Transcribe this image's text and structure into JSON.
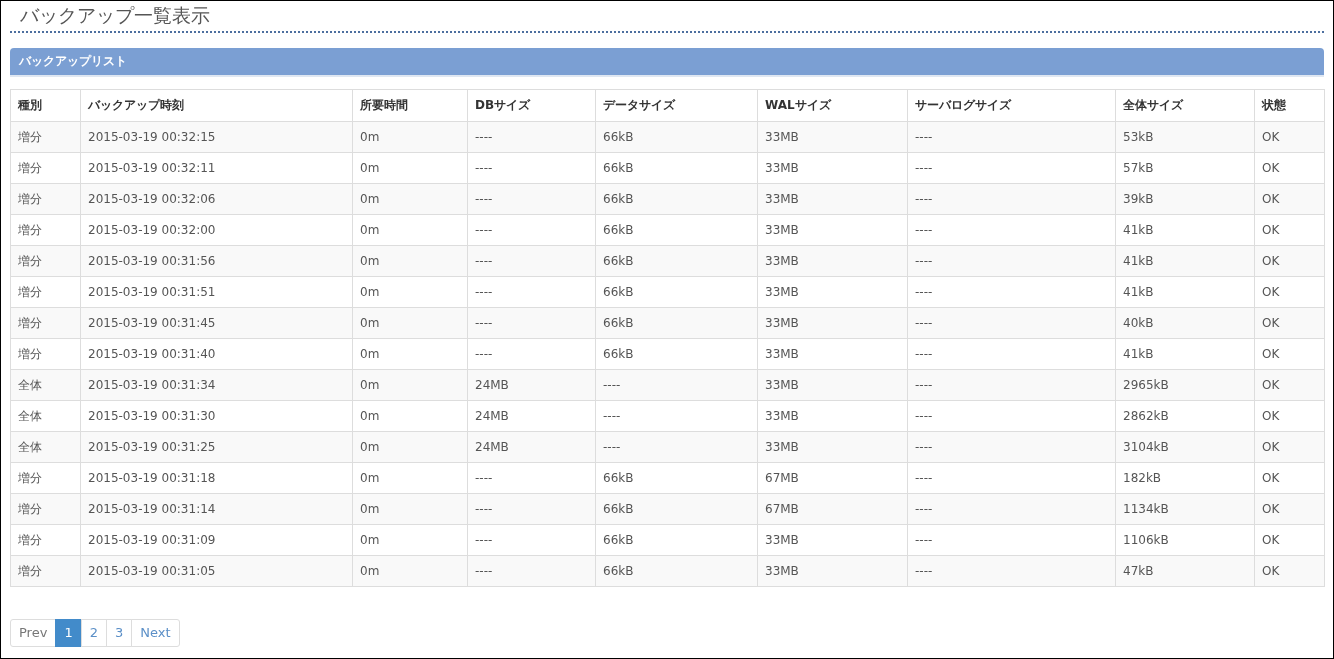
{
  "page_title": "バックアップ一覧表示",
  "panel": {
    "title": "バックアップリスト"
  },
  "table": {
    "columns": [
      "種別",
      "バックアップ時刻",
      "所要時間",
      "DBサイズ",
      "データサイズ",
      "WALサイズ",
      "サーバログサイズ",
      "全体サイズ",
      "状態"
    ],
    "rows": [
      [
        "増分",
        "2015-03-19 00:32:15",
        "0m",
        "----",
        "66kB",
        "33MB",
        "----",
        "53kB",
        "OK"
      ],
      [
        "増分",
        "2015-03-19 00:32:11",
        "0m",
        "----",
        "66kB",
        "33MB",
        "----",
        "57kB",
        "OK"
      ],
      [
        "増分",
        "2015-03-19 00:32:06",
        "0m",
        "----",
        "66kB",
        "33MB",
        "----",
        "39kB",
        "OK"
      ],
      [
        "増分",
        "2015-03-19 00:32:00",
        "0m",
        "----",
        "66kB",
        "33MB",
        "----",
        "41kB",
        "OK"
      ],
      [
        "増分",
        "2015-03-19 00:31:56",
        "0m",
        "----",
        "66kB",
        "33MB",
        "----",
        "41kB",
        "OK"
      ],
      [
        "増分",
        "2015-03-19 00:31:51",
        "0m",
        "----",
        "66kB",
        "33MB",
        "----",
        "41kB",
        "OK"
      ],
      [
        "増分",
        "2015-03-19 00:31:45",
        "0m",
        "----",
        "66kB",
        "33MB",
        "----",
        "40kB",
        "OK"
      ],
      [
        "増分",
        "2015-03-19 00:31:40",
        "0m",
        "----",
        "66kB",
        "33MB",
        "----",
        "41kB",
        "OK"
      ],
      [
        "全体",
        "2015-03-19 00:31:34",
        "0m",
        "24MB",
        "----",
        "33MB",
        "----",
        "2965kB",
        "OK"
      ],
      [
        "全体",
        "2015-03-19 00:31:30",
        "0m",
        "24MB",
        "----",
        "33MB",
        "----",
        "2862kB",
        "OK"
      ],
      [
        "全体",
        "2015-03-19 00:31:25",
        "0m",
        "24MB",
        "----",
        "33MB",
        "----",
        "3104kB",
        "OK"
      ],
      [
        "増分",
        "2015-03-19 00:31:18",
        "0m",
        "----",
        "66kB",
        "67MB",
        "----",
        "182kB",
        "OK"
      ],
      [
        "増分",
        "2015-03-19 00:31:14",
        "0m",
        "----",
        "66kB",
        "67MB",
        "----",
        "1134kB",
        "OK"
      ],
      [
        "増分",
        "2015-03-19 00:31:09",
        "0m",
        "----",
        "66kB",
        "33MB",
        "----",
        "1106kB",
        "OK"
      ],
      [
        "増分",
        "2015-03-19 00:31:05",
        "0m",
        "----",
        "66kB",
        "33MB",
        "----",
        "47kB",
        "OK"
      ]
    ]
  },
  "pagination": [
    {
      "label": "Prev",
      "selected": false
    },
    {
      "label": "1",
      "selected": true
    },
    {
      "label": "2",
      "selected": false
    },
    {
      "label": "3",
      "selected": false
    },
    {
      "label": "Next",
      "selected": false
    }
  ]
}
